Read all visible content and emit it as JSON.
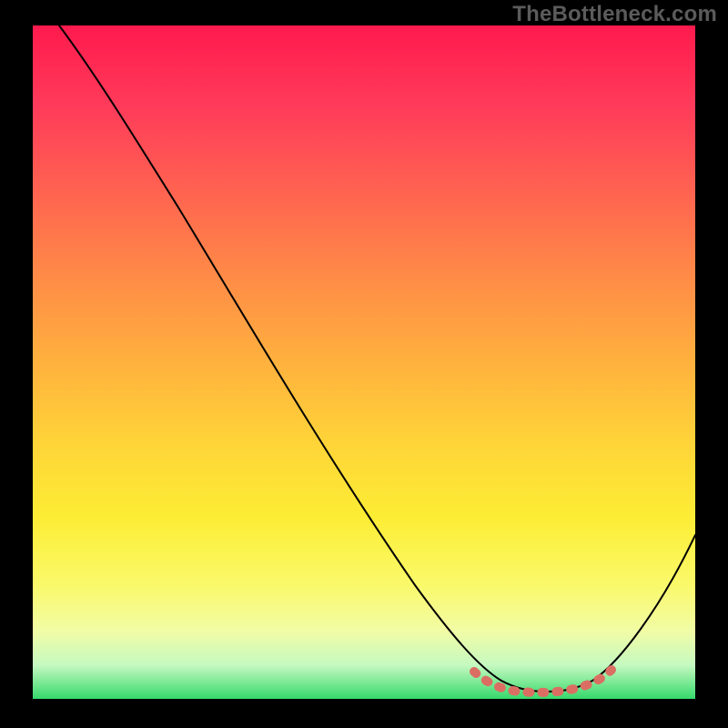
{
  "watermark": "TheBottleneck.com",
  "chart_data": {
    "type": "line",
    "title": "",
    "xlabel": "",
    "ylabel": "",
    "xlim": [
      0,
      100
    ],
    "ylim": [
      0,
      100
    ],
    "series": [
      {
        "name": "curve",
        "x": [
          4,
          12,
          22,
          34,
          46,
          58,
          66,
          70,
          74,
          78,
          82,
          86,
          90,
          96,
          100
        ],
        "y": [
          100,
          90,
          77,
          61,
          44,
          27,
          13,
          6,
          2,
          1,
          1,
          2,
          5,
          15,
          27
        ]
      }
    ],
    "highlight_range_x": [
      67,
      87
    ],
    "background_gradient": {
      "top": "#ff1a4d",
      "mid": "#ffd438",
      "bottom": "#35d96b"
    },
    "grid": false,
    "legend": false
  }
}
